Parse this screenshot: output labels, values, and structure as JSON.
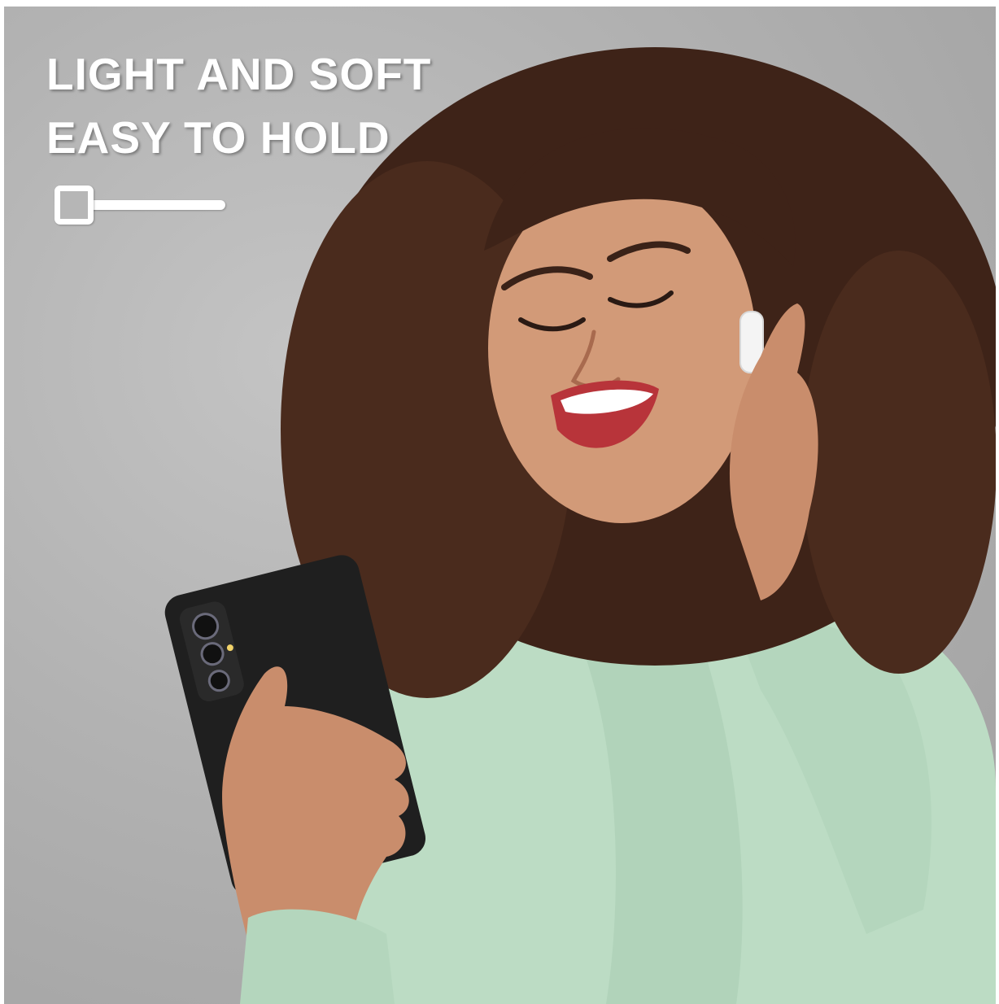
{
  "headline": {
    "line1": "LIGHT AND SOFT",
    "line2": "EASY TO HOLD"
  },
  "slider": {
    "value": 0,
    "knob_icon": "rounded-square-knob-icon"
  },
  "colors": {
    "background": "#b2b2b2",
    "text": "#ffffff",
    "phone_case": "#1f1f1f",
    "sweater": "#bcdcc4",
    "hair": "#3e2318"
  }
}
